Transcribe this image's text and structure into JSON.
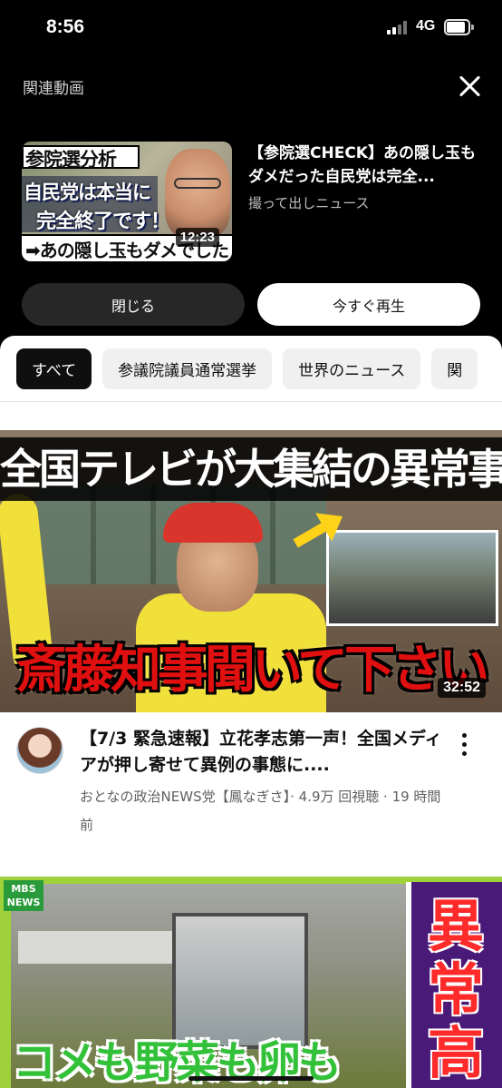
{
  "status_bar": {
    "time": "8:56",
    "network": "4G"
  },
  "related": {
    "header": "関連動画",
    "video": {
      "thumbnail_caption_1": "参院選分析",
      "thumbnail_caption_2": "自民党は本当に",
      "thumbnail_caption_3": "完全終了です！",
      "thumbnail_caption_4": "➡あの隠し玉もダメでした",
      "duration": "12:23",
      "title": "【参院選CHECK】あの隠し玉もダメだった自民党は完全...",
      "channel": "撮って出しニュース"
    },
    "close_button": "閉じる",
    "play_now_button": "今すぐ再生"
  },
  "chips": [
    {
      "label": "すべて"
    },
    {
      "label": "参議院議員通常選挙"
    },
    {
      "label": "世界のニュース"
    },
    {
      "label": "関"
    }
  ],
  "feed": {
    "video1": {
      "thumbnail_caption_top": "全国テレビが大集結の異常事態",
      "thumbnail_caption_bottom": "斎藤知事聞いて下さい",
      "duration": "32:52",
      "title": "【7/3 緊急速報】立花孝志第一声！全国メディアが押し寄せて異例の事態に....",
      "meta": "おとなの政治NEWS党【鳳なぎさ】· 4.9万 回視聴 · 19 時間前"
    },
    "video2": {
      "logo_text": "MBS NEWS",
      "thumbnail_caption": "コメも野菜も卵も",
      "side_text": "異常高"
    }
  },
  "colors": {
    "background": "#000000",
    "sheet": "#ffffff",
    "chip_active": "#0f0f0f",
    "chip_inactive": "#f0f0f0",
    "caption_red": "#e01010"
  }
}
